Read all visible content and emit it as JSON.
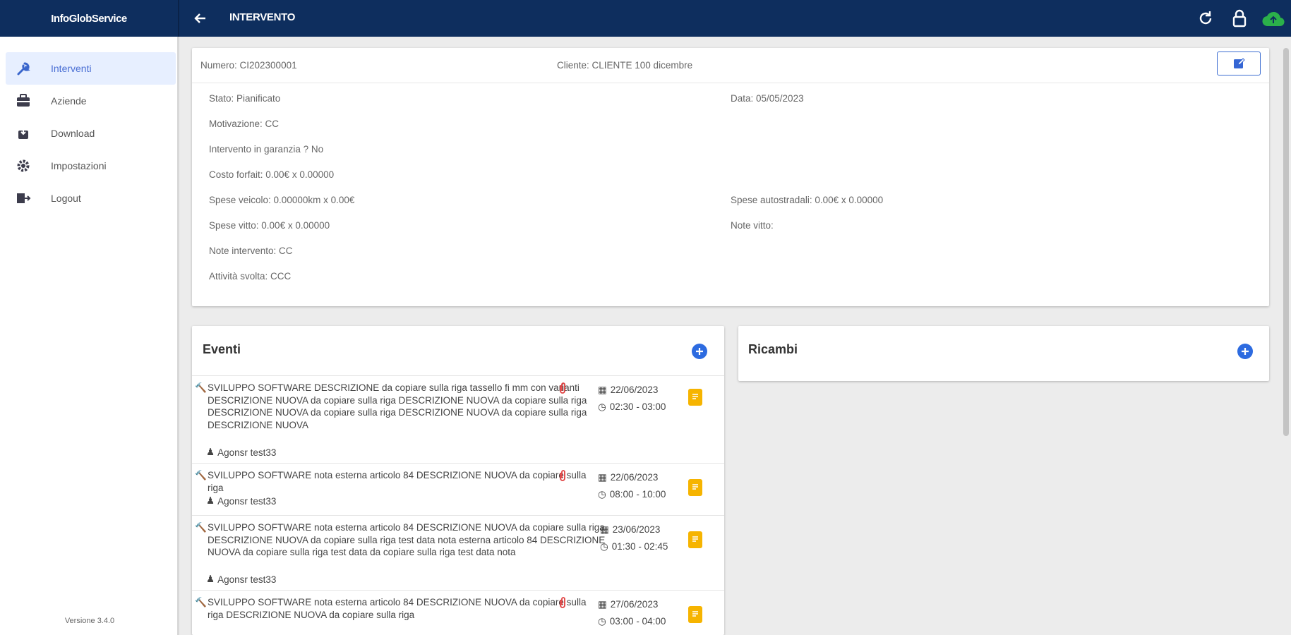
{
  "app": {
    "brand": "InfoGlobService",
    "page_title": "INTERVENTO",
    "version": "Versione 3.4.0"
  },
  "sidebar": {
    "items": [
      {
        "label": "Interventi",
        "icon": "wrench-icon"
      },
      {
        "label": "Aziende",
        "icon": "briefcase-icon"
      },
      {
        "label": "Download",
        "icon": "download-icon"
      },
      {
        "label": "Impostazioni",
        "icon": "gear-icon"
      },
      {
        "label": "Logout",
        "icon": "logout-icon"
      }
    ]
  },
  "details": {
    "numero": "Numero: CI202300001",
    "cliente": "Cliente: CLIENTE 100 dicembre",
    "stato": "Stato: Pianificato",
    "data": "Data: 05/05/2023",
    "motivazione": "Motivazione: CC",
    "garanzia": "Intervento in garanzia ? No",
    "costo_forfait": "Costo forfait: 0.00€ x 0.00000",
    "spese_veicolo": "Spese veicolo: 0.00000km x 0.00€",
    "spese_autostradali": "Spese autostradali: 0.00€ x 0.00000",
    "spese_vitto": "Spese vitto: 0.00€ x 0.00000",
    "note_vitto": "Note vitto:",
    "note_intervento": "Note intervento: CC",
    "attivita": "Attività svolta: CCC"
  },
  "eventi": {
    "title": "Eventi",
    "rows": [
      {
        "text": "SVILUPPO SOFTWARE DESCRIZIONE da copiare sulla riga tassello fi mm con varianti DESCRIZIONE NUOVA da copiare sulla riga DESCRIZIONE NUOVA da copiare sulla riga DESCRIZIONE NUOVA da copiare sulla riga DESCRIZIONE NUOVA da copiare sulla riga DESCRIZIONE NUOVA",
        "agent": "Agonsr test33",
        "date": "22/06/2023",
        "time": "02:30 - 03:00"
      },
      {
        "text": "SVILUPPO SOFTWARE nota esterna articolo 84 DESCRIZIONE NUOVA da copiare sulla riga",
        "agent": "Agonsr test33",
        "date": "22/06/2023",
        "time": "08:00 - 10:00"
      },
      {
        "text": "SVILUPPO SOFTWARE nota esterna articolo 84 DESCRIZIONE NUOVA da copiare sulla riga DESCRIZIONE NUOVA da copiare sulla riga test data nota esterna articolo 84 DESCRIZIONE NUOVA da copiare sulla riga test data da copiare sulla riga test data nota",
        "agent": "Agonsr test33",
        "date": "23/06/2023",
        "time": "01:30 - 02:45"
      },
      {
        "text": "SVILUPPO SOFTWARE nota esterna articolo 84 DESCRIZIONE NUOVA da copiare sulla riga DESCRIZIONE NUOVA da copiare sulla riga",
        "agent": "Agonsr test33",
        "date": "27/06/2023",
        "time": "03:00 - 04:00"
      }
    ]
  },
  "ricambi": {
    "title": "Ricambi"
  },
  "colors": {
    "topbar": "#0e2e5e",
    "accent": "#2d6be0",
    "note": "#f6b400",
    "clip": "#e04040",
    "cloud": "#2bb04a"
  }
}
